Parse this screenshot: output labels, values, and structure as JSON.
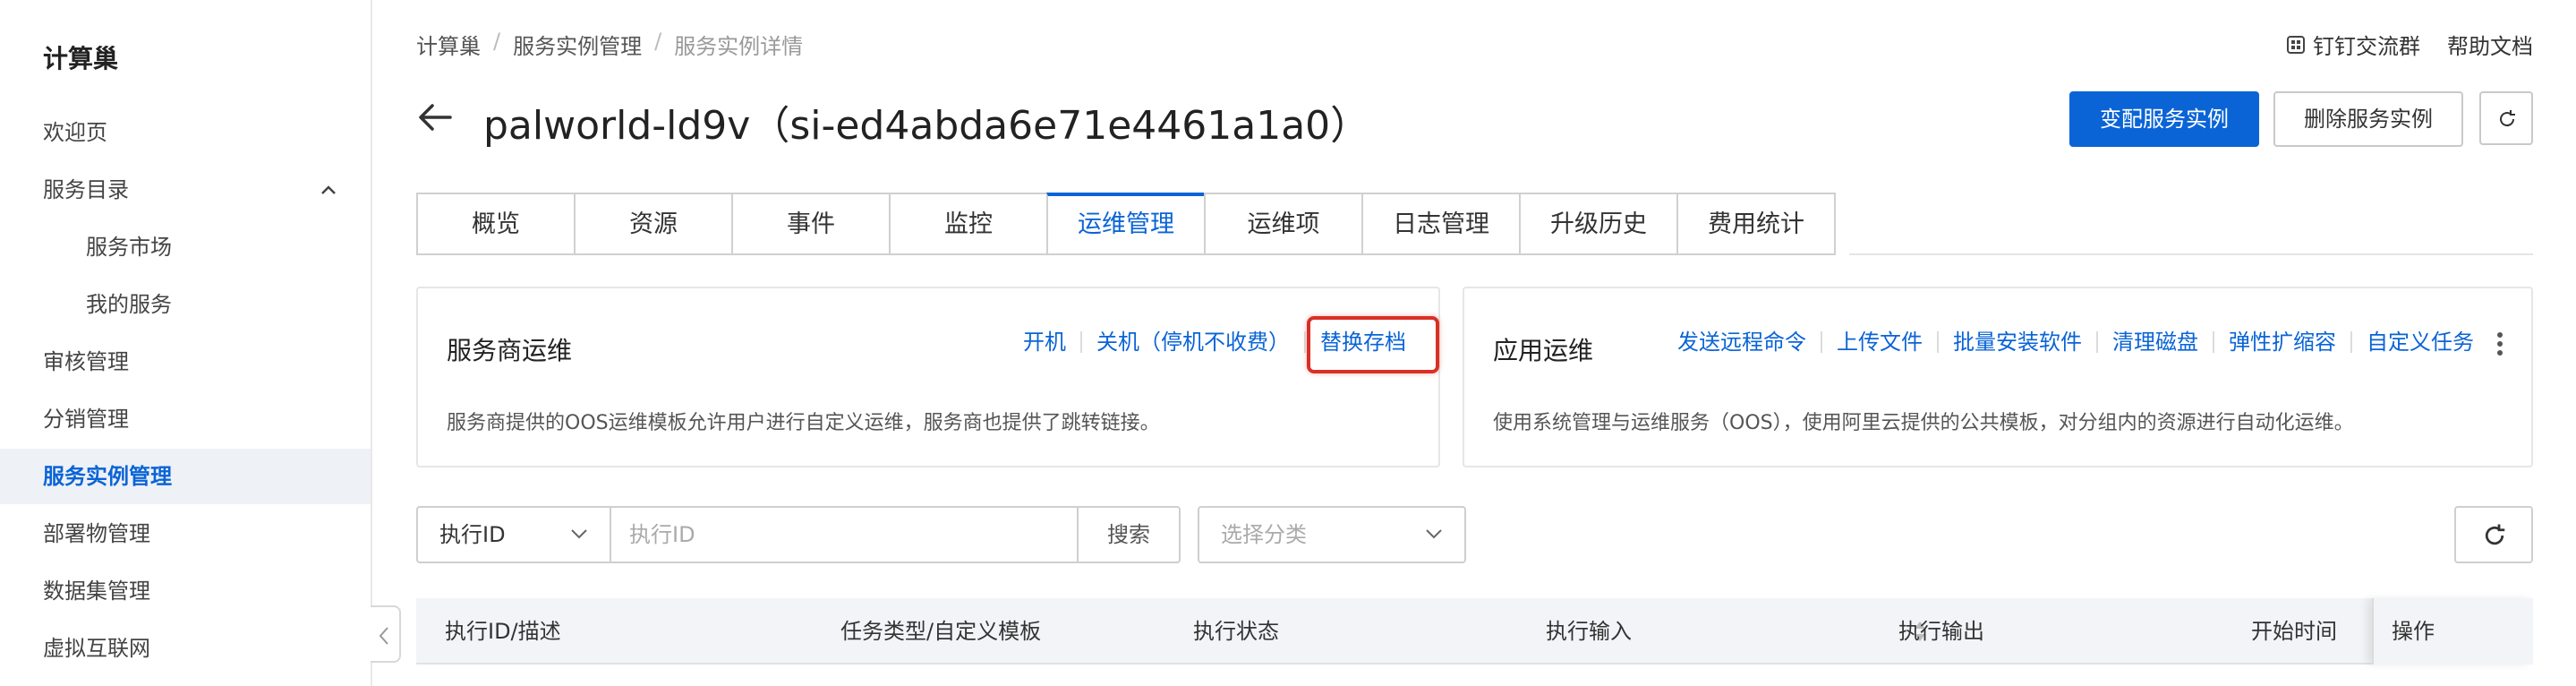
{
  "sidebar": {
    "title": "计算巢",
    "items": [
      {
        "label": "欢迎页"
      },
      {
        "label": "服务目录"
      },
      {
        "label": "服务市场"
      },
      {
        "label": "我的服务"
      },
      {
        "label": "审核管理"
      },
      {
        "label": "分销管理"
      },
      {
        "label": "服务实例管理"
      },
      {
        "label": "部署物管理"
      },
      {
        "label": "数据集管理"
      },
      {
        "label": "虚拟互联网"
      }
    ]
  },
  "breadcrumb": [
    "计算巢",
    "服务实例管理",
    "服务实例详情"
  ],
  "top_links": {
    "dingtalk": "钉钉交流群",
    "help": "帮助文档"
  },
  "header": {
    "title": "palworld-ld9v（si-ed4abda6e71e4461a1a0）",
    "primary_button": "变配服务实例",
    "delete_button": "删除服务实例"
  },
  "tabs": [
    "概览",
    "资源",
    "事件",
    "监控",
    "运维管理",
    "运维项",
    "日志管理",
    "升级历史",
    "费用统计"
  ],
  "active_tab": "运维管理",
  "provider_card": {
    "title": "服务商运维",
    "links": [
      "开机",
      "关机（停机不收费）",
      "替换存档"
    ],
    "desc": "服务商提供的OOS运维模板允许用户进行自定义运维，服务商也提供了跳转链接。"
  },
  "app_card": {
    "title": "应用运维",
    "links": [
      "发送远程命令",
      "上传文件",
      "批量安装软件",
      "清理磁盘",
      "弹性扩缩容",
      "自定义任务"
    ],
    "desc": "使用系统管理与运维服务（OOS），使用阿里云提供的公共模板，对分组内的资源进行自动化运维。"
  },
  "filter": {
    "field_select": "执行ID",
    "input_placeholder": "执行ID",
    "search_label": "搜索",
    "category_placeholder": "选择分类"
  },
  "table": {
    "columns": [
      "执行ID/描述",
      "任务类型/自定义模板",
      "执行状态",
      "执行输入",
      "执行输出",
      "开始时间",
      "操作"
    ]
  },
  "colors": {
    "accent": "#0a64d6",
    "highlight": "#d93025"
  }
}
